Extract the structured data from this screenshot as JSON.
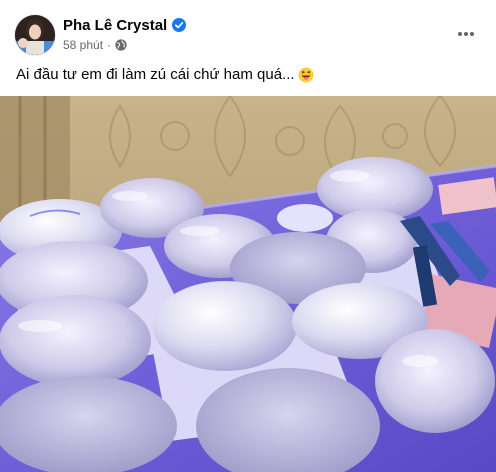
{
  "post": {
    "author": {
      "name": "Pha Lê Crystal",
      "verified": true
    },
    "meta": {
      "time": "58 phút",
      "separator": "·",
      "audience_icon": "globe-icon"
    },
    "more_icon": "more-options-icon",
    "caption": {
      "text": "Ai đầu tư em đi làm zú cái chứ ham quá...",
      "emoji": "laughing-tongue-emoji-icon"
    },
    "photo": {
      "description_icon": "photo"
    }
  },
  "colors": {
    "verified_blue": "#1877f2",
    "meta_gray": "#65676b",
    "text_dark": "#050505",
    "table_purple": "#6b5ad6"
  }
}
